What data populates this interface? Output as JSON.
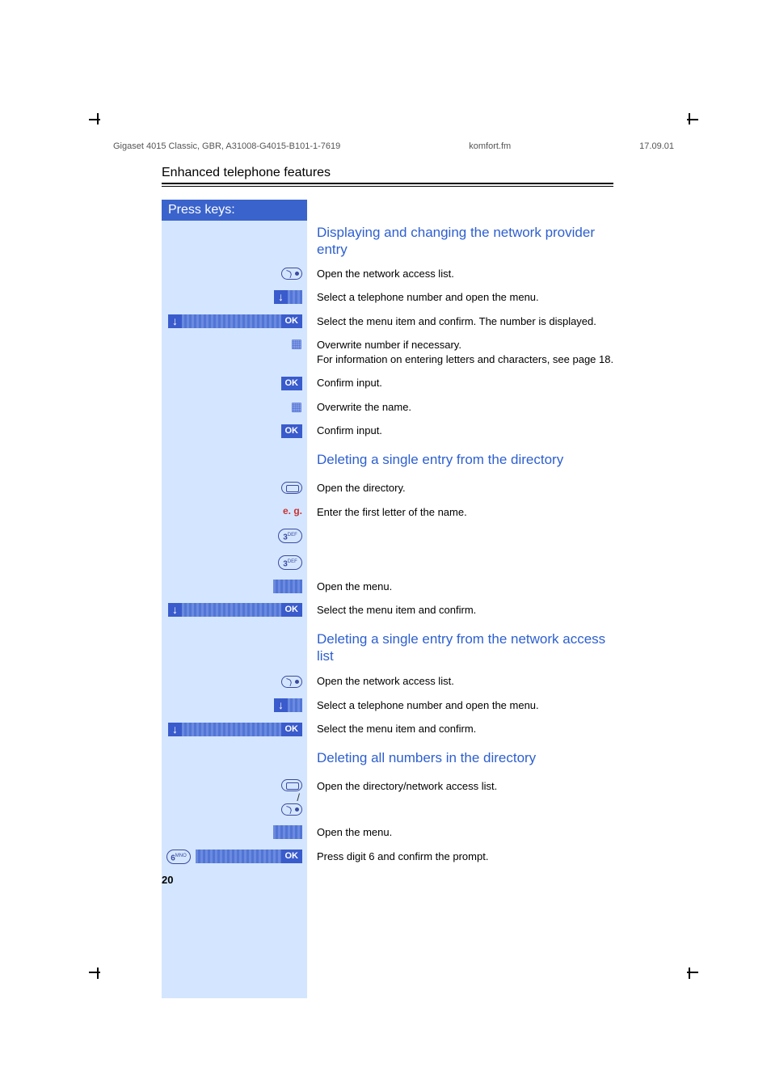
{
  "header": {
    "doc_id": "Gigaset 4015 Classic, GBR, A31008-G4015-B101-1-7619",
    "file": "komfort.fm",
    "date": "17.09.01"
  },
  "section_title": "Enhanced telephone features",
  "press_keys": "Press keys:",
  "headings": {
    "h1": "Displaying and changing the network provider entry",
    "h2": "Deleting a single entry from the directory",
    "h3": "Deleting a single entry from the network access list",
    "h4": "Deleting all numbers in the directory"
  },
  "steps": {
    "s1": "Open the network access list.",
    "s2": "Select a telephone number and open the menu.",
    "s3": "Select the menu item and confirm. The number is displayed.",
    "s4": "Overwrite number if necessary.\nFor information on entering letters and characters, see page 18.",
    "s5": "Confirm input.",
    "s6": "Overwrite the name.",
    "s7": "Confirm input.",
    "s8": "Open the directory.",
    "s9": "Enter the first letter of the name.",
    "s10": "Open the menu.",
    "s11": "Select the menu item and confirm.",
    "s12": "Open the network access list.",
    "s13": "Select a telephone number and open the menu.",
    "s14": "Select the menu item and confirm.",
    "s15": "Open the directory/network access list.",
    "s16": "Open the menu.",
    "s17": "Press digit 6 and confirm the prompt."
  },
  "labels": {
    "ok": "OK",
    "down": "↓",
    "eg": "e. g.",
    "key3": "3",
    "key3sup": "DEF",
    "key6": "6",
    "key6sup": "MNO",
    "slash": "/"
  },
  "page_number": "20"
}
